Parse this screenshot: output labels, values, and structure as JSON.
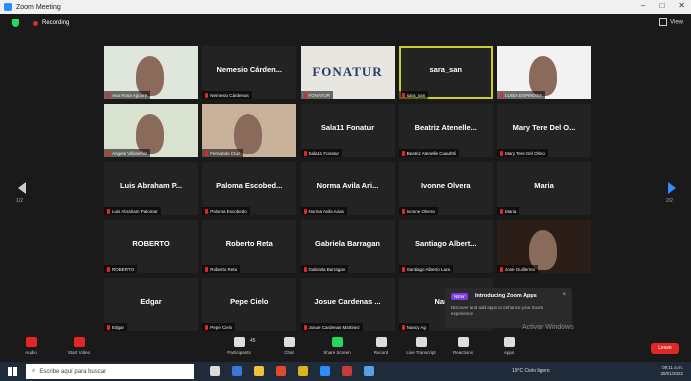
{
  "window": {
    "title": "Zoom Meeting"
  },
  "topbar": {
    "recording": "Recording",
    "view": "View"
  },
  "pages": {
    "left": "1/2",
    "right": "2/2"
  },
  "tiles": [
    {
      "name": "",
      "label": "Ana Rosa Aguirre",
      "video": true,
      "bg": "#dfe7dc"
    },
    {
      "name": "Nemesio Cárden...",
      "label": "Nemesio Cárdenas",
      "video": false
    },
    {
      "name": "",
      "label": "FONATUR",
      "video": true,
      "bg": "#e8e6e0",
      "logo": "FONATUR"
    },
    {
      "name": "sara_san",
      "label": "sara_san",
      "video": false,
      "active": true
    },
    {
      "name": "",
      "label": "LUISA ESPINOSA",
      "video": true,
      "bg": "#f2f2f2"
    },
    {
      "name": "",
      "label": "Angela Villaseñor",
      "video": true,
      "bg": "#d8e2ce"
    },
    {
      "name": "",
      "label": "Fernando Cruz",
      "video": true,
      "bg": "#c9b29a"
    },
    {
      "name": "Sala11 Fonatur",
      "label": "Sala11 Fonatur",
      "video": false
    },
    {
      "name": "Beatriz Atenelle...",
      "label": "Beatriz Atenelle Cuauhtli",
      "video": false
    },
    {
      "name": "Mary Tere Del O...",
      "label": "Mary Tere Del Olmo",
      "video": false
    },
    {
      "name": "Luis Abraham P...",
      "label": "Luis Abraham Palomar",
      "video": false
    },
    {
      "name": "Paloma Escobed...",
      "label": "Paloma Escobedo",
      "video": false
    },
    {
      "name": "Norma Avila Ari...",
      "label": "Norma Avila Arias",
      "video": false
    },
    {
      "name": "Ivonne Olvera",
      "label": "Ivonne Olvera",
      "video": false
    },
    {
      "name": "Maria",
      "label": "Maria",
      "video": false
    },
    {
      "name": "ROBERTO",
      "label": "ROBERTO",
      "video": false
    },
    {
      "name": "Roberto Reta",
      "label": "Roberto Reta",
      "video": false
    },
    {
      "name": "Gabriela Barragan",
      "label": "Gabriela Barragan",
      "video": false
    },
    {
      "name": "Santiago Albert...",
      "label": "Santiago Alberto Lara",
      "video": false
    },
    {
      "name": "",
      "label": "Jose Guillermo",
      "video": true,
      "bg": "#2b1e18"
    },
    {
      "name": "Edgar",
      "label": "Edgar",
      "video": false
    },
    {
      "name": "Pepe Cielo",
      "label": "Pepe Cielo",
      "video": false
    },
    {
      "name": "Josue Cardenas ...",
      "label": "Josue Cardenas Martinez",
      "video": false
    },
    {
      "name": "Nancy",
      "label": "Nancy Ag",
      "video": false
    },
    {
      "name": "",
      "label": "",
      "video": false,
      "hidden": true
    }
  ],
  "toast": {
    "badge": "NEW",
    "title": "Introducing Zoom Apps",
    "body": "Discover and add apps to enhance your Zoom experience",
    "close": "×"
  },
  "watermark": {
    "line1": "Activar Windows",
    "line2": "Ve a Configuración para activar Windows."
  },
  "toolbar": {
    "buttons": [
      {
        "label": "Audio",
        "icon": "microphone-muted-icon",
        "color": "red"
      },
      {
        "label": "Start Video",
        "icon": "video-off-icon",
        "color": "red"
      },
      {
        "label": "Participants",
        "icon": "participants-icon",
        "color": "gray"
      },
      {
        "label": "Chat",
        "icon": "chat-icon",
        "color": "gray"
      },
      {
        "label": "Share Screen",
        "icon": "share-screen-icon",
        "color": "green"
      },
      {
        "label": "Record",
        "icon": "record-icon",
        "color": "gray"
      },
      {
        "label": "Live Transcript",
        "icon": "cc-icon",
        "color": "gray"
      },
      {
        "label": "Reactions",
        "icon": "reactions-icon",
        "color": "gray"
      },
      {
        "label": "Apps",
        "icon": "apps-icon",
        "color": "gray"
      }
    ],
    "participants_count": "45",
    "end": "Leave"
  },
  "taskbar": {
    "search_placeholder": "Escribe aquí para buscar",
    "weather": "19°C Cielo ligero",
    "time": "09:11 a.m.",
    "date": "28/01/2022"
  }
}
